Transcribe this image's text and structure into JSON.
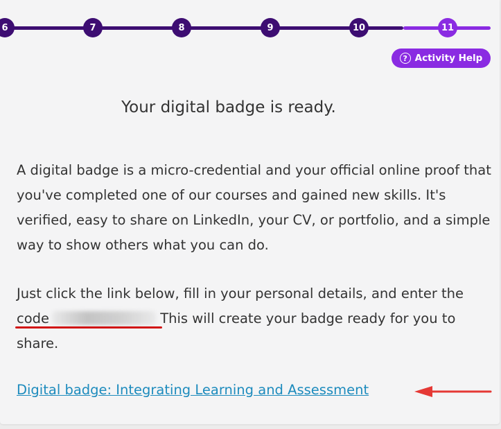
{
  "stepper": {
    "steps": [
      "6",
      "7",
      "8",
      "9",
      "10",
      "11"
    ],
    "active_step": "11"
  },
  "help_button": {
    "label": "Activity Help",
    "icon": "question-circle-icon"
  },
  "heading": "Your digital badge is ready.",
  "paragraph1": "A digital badge is a micro-credential and your official online proof that you've completed one of our courses and gained new skills. It's verified, easy to share on LinkedIn, your CV, or portfolio, and a simple way to show others what you can do.",
  "paragraph2": {
    "before": "Just click the link below, fill in your personal details, and enter the code",
    "after": "This will create your badge ready for you to share."
  },
  "badge_link": "Digital badge: Integrating Learning and Assessment",
  "colors": {
    "step_dark": "#3d0d72",
    "step_active": "#8a2be2",
    "link": "#1d8bbd",
    "annotation": "#d11313",
    "arrow": "#e53935"
  }
}
